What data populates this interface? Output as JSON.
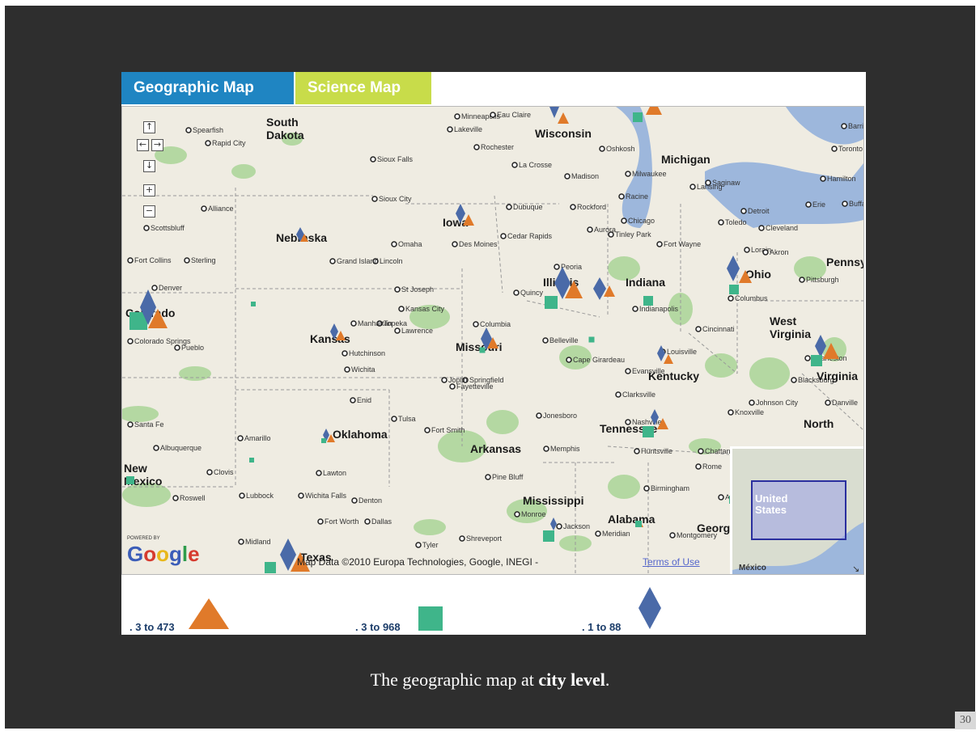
{
  "tabs": [
    {
      "label": "Geographic Map",
      "active": true
    },
    {
      "label": "Science Map",
      "active": false
    }
  ],
  "map": {
    "states": [
      {
        "name": "South Dakota",
        "lines": [
          "South",
          "Dakota"
        ]
      },
      {
        "name": "Nebraska"
      },
      {
        "name": "Kansas"
      },
      {
        "name": "Oklahoma"
      },
      {
        "name": "Texas"
      },
      {
        "name": "Iowa"
      },
      {
        "name": "Missouri"
      },
      {
        "name": "Arkansas"
      },
      {
        "name": "Mississippi"
      },
      {
        "name": "Alabama"
      },
      {
        "name": "Tennessee"
      },
      {
        "name": "Kentucky"
      },
      {
        "name": "Illinois"
      },
      {
        "name": "Indiana"
      },
      {
        "name": "Ohio"
      },
      {
        "name": "Michigan"
      },
      {
        "name": "Wisconsin"
      },
      {
        "name": "West Virginia",
        "lines": [
          "West",
          "Virginia"
        ]
      },
      {
        "name": "Virginia"
      },
      {
        "name": "North Carolina",
        "lines": [
          "North"
        ]
      },
      {
        "name": "Colorado"
      },
      {
        "name": "New Mexico",
        "lines": [
          "New",
          "Mexico"
        ]
      },
      {
        "name": "Georgia"
      },
      {
        "name": "Pennsylvania"
      }
    ],
    "cities": [
      "Spearfish",
      "Rapid City",
      "Sioux Falls",
      "Minneapolis",
      "Eau Claire",
      "Lakeville",
      "Rochester",
      "La Crosse",
      "Madison",
      "Milwaukee",
      "Oshkosh",
      "Lansing",
      "Saginaw",
      "Toronto",
      "Hamilton",
      "Barrie",
      "Buffalo",
      "Erie",
      "Detroit",
      "Toledo",
      "Cleveland",
      "Lorain",
      "Akron",
      "Pittsburgh",
      "Columbus",
      "Cincinnati",
      "Louisville",
      "Charleston",
      "Blacksburg",
      "Johnson City",
      "Danville",
      "Knoxville",
      "Chattanooga",
      "Atlanta",
      "Birmingham",
      "Montgomery",
      "Meridian",
      "Jackson",
      "Monroe",
      "Shreveport",
      "Tyler",
      "Dallas",
      "Fort Worth",
      "Denton",
      "Wichita Falls",
      "Lawton",
      "Lubbock",
      "Midland",
      "Roswell",
      "Clovis",
      "Amarillo",
      "Albuquerque",
      "Enid",
      "Tulsa",
      "Fort Smith",
      "Fayetteville",
      "Jonesboro",
      "Memphis",
      "Huntsville",
      "Rome",
      "Nashville",
      "Clarksville",
      "Evansville",
      "Cape Girardeau",
      "Belleville",
      "Springfield",
      "Columbia",
      "Kansas City",
      "Topeka",
      "Manhattan",
      "Lawrence",
      "Hutchinson",
      "Wichita",
      "Joplin",
      "Pine Bluff",
      "St Joseph",
      "Quincy",
      "Peoria",
      "Indianapolis",
      "Fort Wayne",
      "Chicago",
      "Tinley Park",
      "Aurora",
      "Rockford",
      "Dubuque",
      "Racine",
      "Cedar Rapids",
      "Des Moines",
      "Sioux City",
      "Omaha",
      "Lincoln",
      "Grand Island",
      "Scottsbluff",
      "Alliance",
      "Fort Collins",
      "Sterling",
      "Denver",
      "Colorado Springs",
      "Pueblo",
      "Santa Fe"
    ],
    "attribution": "Map Data ©2010 Europa Technologies, Google, INEGI - ",
    "terms_link": "Terms of Use",
    "inset": {
      "country": "United States",
      "lines": [
        "United",
        "States"
      ],
      "neighbor": "México"
    },
    "logo": "Google",
    "powered_by": "POWERED BY"
  },
  "legend": [
    {
      "shape": "triangle",
      "color": "#e07a2a",
      "label": ". 3 to 473"
    },
    {
      "shape": "square",
      "color": "#3fb58a",
      "label": ". 3 to 968"
    },
    {
      "shape": "diamond",
      "color": "#4a6aa8",
      "label": ". 1 to 88"
    }
  ],
  "caption": {
    "prefix": "The geographic map at ",
    "bold": "city level",
    "suffix": "."
  },
  "page_number": "30",
  "colors": {
    "background": "#2e2e2e",
    "tab_geo": "#1f85c2",
    "tab_sci": "#c8dc4a",
    "triangle": "#e07a2a",
    "square": "#3fb58a",
    "diamond": "#4a6aa8",
    "map_land": "#efece2",
    "map_green": "#9fcf8d",
    "water": "#9db7dc"
  }
}
